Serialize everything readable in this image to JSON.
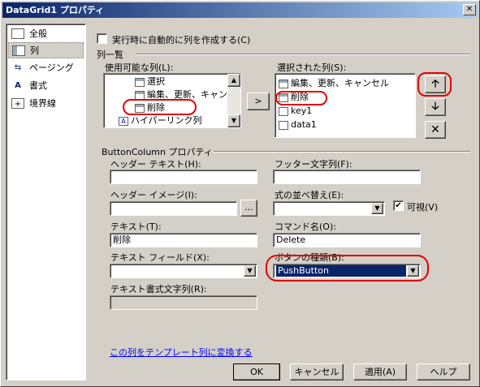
{
  "window": {
    "title": "DataGrid1 プロパティ",
    "close_glyph": "✕"
  },
  "sidebar": {
    "items": [
      {
        "label": "全般",
        "icon": "general-icon"
      },
      {
        "label": "列",
        "icon": "columns-icon"
      },
      {
        "label": "ページング",
        "icon": "paging-icon"
      },
      {
        "label": "書式",
        "icon": "format-icon"
      },
      {
        "label": "境界線",
        "icon": "borders-icon"
      }
    ],
    "selected": "列"
  },
  "auto_generate": {
    "label": "実行時に自動的に列を作成する(C)",
    "checked": false
  },
  "columns_group": {
    "label": "列一覧"
  },
  "available": {
    "label": "使用可能な列(L):",
    "items": [
      "選択",
      "編集、更新、キャンセル",
      "削除",
      "ハイパーリンク列"
    ]
  },
  "add_button": {
    "label": ">"
  },
  "selected_columns": {
    "label": "選択された列(S):",
    "items": [
      "編集、更新、キャンセル",
      "削除",
      "key1",
      "data1"
    ],
    "selected": "削除"
  },
  "order_buttons": {
    "up": "🡡",
    "down": "🡣",
    "delete": "✕"
  },
  "props_group": {
    "label": "ButtonColumn プロパティ"
  },
  "fields": {
    "header_text": {
      "label": "ヘッダー テキスト(H):",
      "value": ""
    },
    "footer_text": {
      "label": "フッター文字列(F):",
      "value": ""
    },
    "header_image": {
      "label": "ヘッダー イメージ(I):",
      "value": "",
      "browse": "..."
    },
    "sort_expression": {
      "label": "式の並べ替え(E):",
      "value": ""
    },
    "visible": {
      "label": "可視(V)",
      "checked": true
    },
    "text": {
      "label": "テキスト(T):",
      "value": "削除"
    },
    "command_name": {
      "label": "コマンド名(O):",
      "value": "Delete"
    },
    "text_field": {
      "label": "テキスト フィールド(X):",
      "value": ""
    },
    "button_type": {
      "label": "ボタンの種類(B):",
      "value": "PushButton"
    },
    "text_format": {
      "label": "テキスト書式文字列(R):",
      "value": ""
    }
  },
  "convert_link": {
    "label": "この列をテンプレート列に変換する"
  },
  "footer_buttons": {
    "ok": "OK",
    "cancel": "キャンセル",
    "apply": "適用(A)",
    "help": "ヘルプ"
  },
  "colors": {
    "annotation": "#e00000",
    "title_start": "#0a246a",
    "selection": "#0a246a"
  }
}
